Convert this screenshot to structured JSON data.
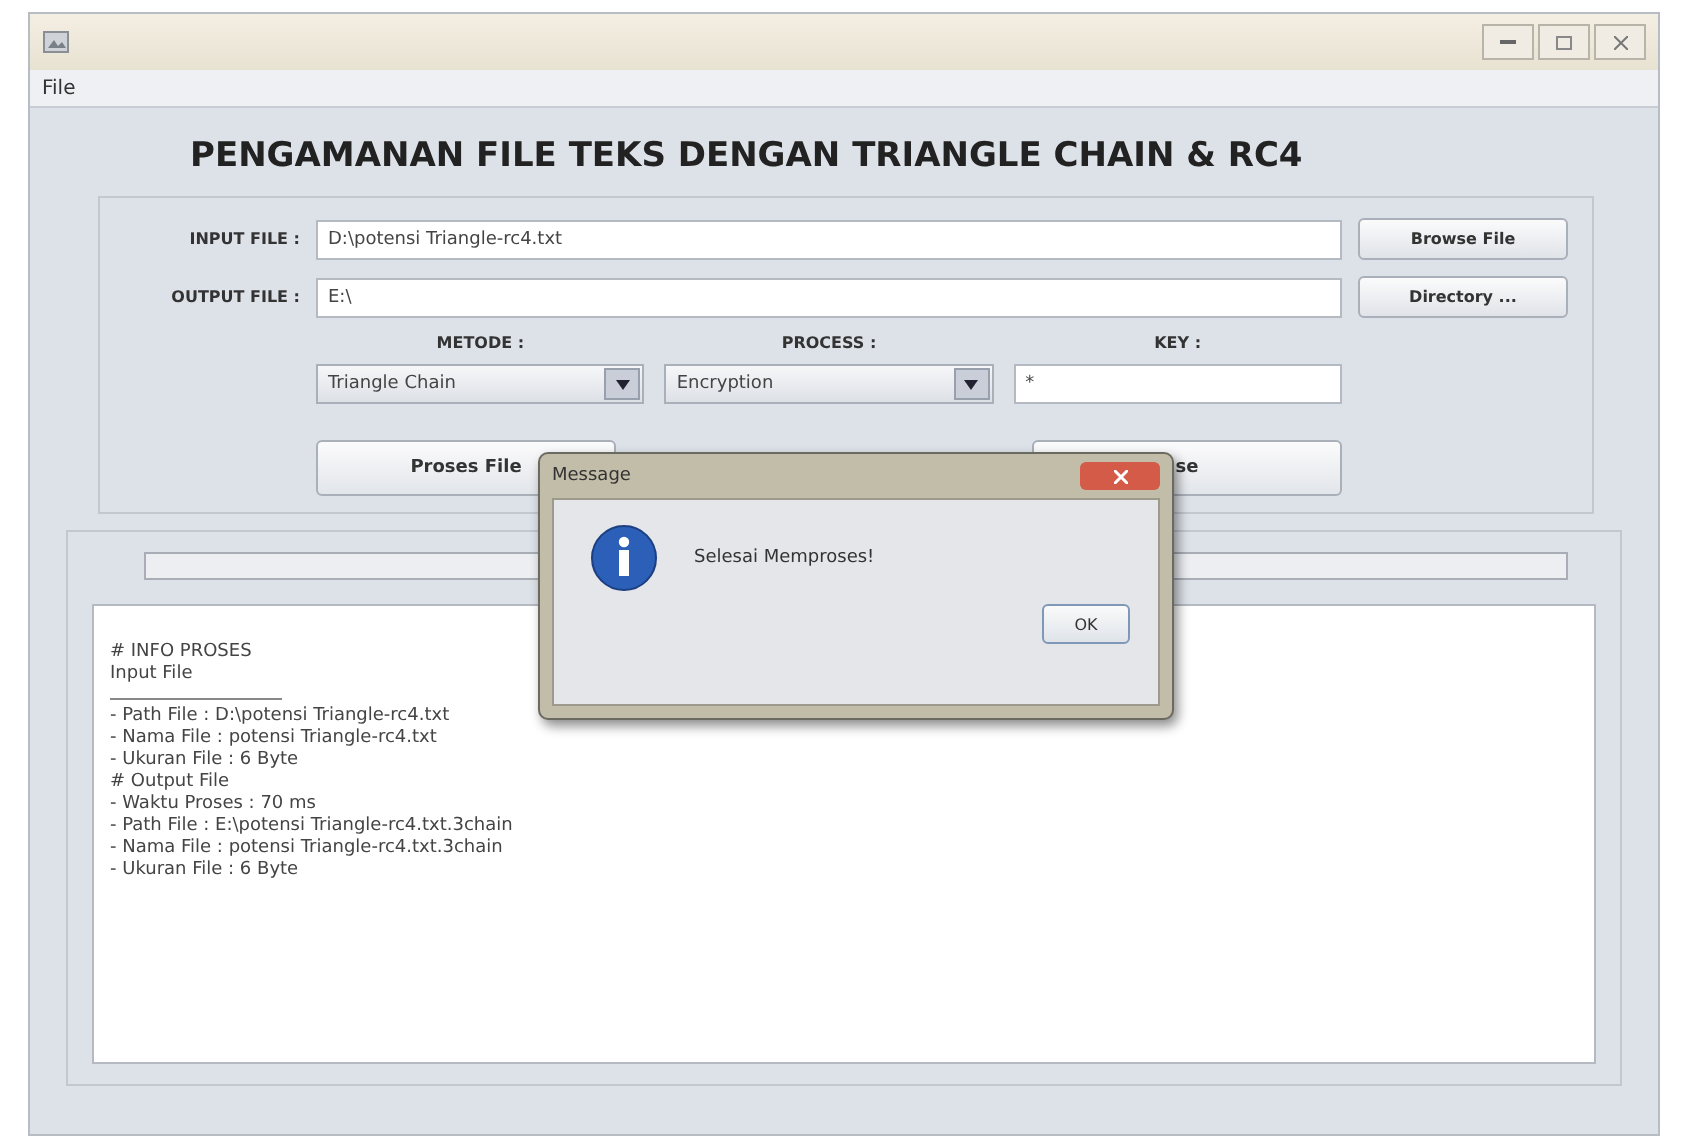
{
  "menu": [
    "File"
  ],
  "heading": "PENGAMANAN FILE TEKS DENGAN TRIANGLE CHAIN & RC4",
  "input_file": {
    "label": "INPUT FILE :",
    "value": "D:\\potensi Triangle-rc4.txt",
    "button": "Browse File"
  },
  "output_file": {
    "label": "OUTPUT FILE :",
    "value": "E:\\",
    "button": "Directory ..."
  },
  "options": [
    {
      "kind": "select",
      "label": "METODE :",
      "value": "Triangle Chain"
    },
    {
      "kind": "select",
      "label": "PROCESS :",
      "value": "Encryption"
    },
    {
      "kind": "input",
      "label": "KEY :",
      "value": "*"
    }
  ],
  "actions": [
    "Proses File",
    "se"
  ],
  "log": {
    "heading": "# INFO PROSES",
    "subheading": "Input File",
    "lines": [
      "- Path File : D:\\potensi Triangle-rc4.txt",
      "- Nama File : potensi Triangle-rc4.txt",
      "- Ukuran File : 6 Byte",
      "# Output File",
      "- Waktu Proses : 70 ms",
      "- Path File : E:\\potensi Triangle-rc4.txt.3chain",
      "- Nama File : potensi Triangle-rc4.txt.3chain",
      "- Ukuran File : 6 Byte"
    ]
  },
  "dialog": {
    "title": "Message",
    "message": "Selesai Memproses!",
    "button": "OK"
  }
}
